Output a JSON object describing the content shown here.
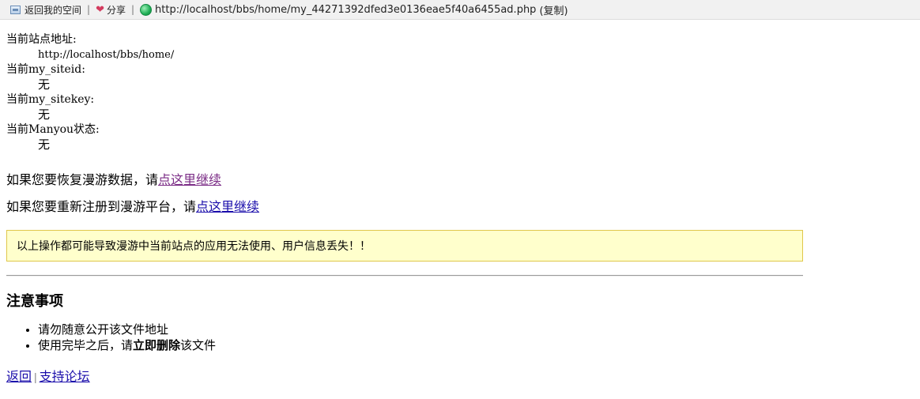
{
  "topbar": {
    "home_label": "返回我的空间",
    "share_label": "分享",
    "url": "http://localhost/bbs/home/my_44271392dfed3e0136eae5f40a6455ad.php",
    "copy_label": "(复制)"
  },
  "site_info": {
    "items": [
      {
        "label": "当前站点地址:",
        "value": "http://localhost/bbs/home/"
      },
      {
        "label": "当前my_siteid:",
        "value": "无"
      },
      {
        "label": "当前my_sitekey:",
        "value": "无"
      },
      {
        "label": "当前Manyou状态:",
        "value": "无"
      }
    ]
  },
  "actions": {
    "restore_text": "如果您要恢复漫游数据，请",
    "restore_link": "点这里继续",
    "register_text": "如果您要重新注册到漫游平台，请",
    "register_link": "点这里继续"
  },
  "notice": "以上操作都可能导致漫游中当前站点的应用无法使用、用户信息丢失！！",
  "notes": {
    "title": "注意事项",
    "item1": "请勿随意公开该文件地址",
    "item2_prefix": "使用完毕之后，请",
    "item2_bold": "立即删除",
    "item2_suffix": "该文件"
  },
  "footer": {
    "back": "返回",
    "separator": "|",
    "support": "支持论坛"
  }
}
